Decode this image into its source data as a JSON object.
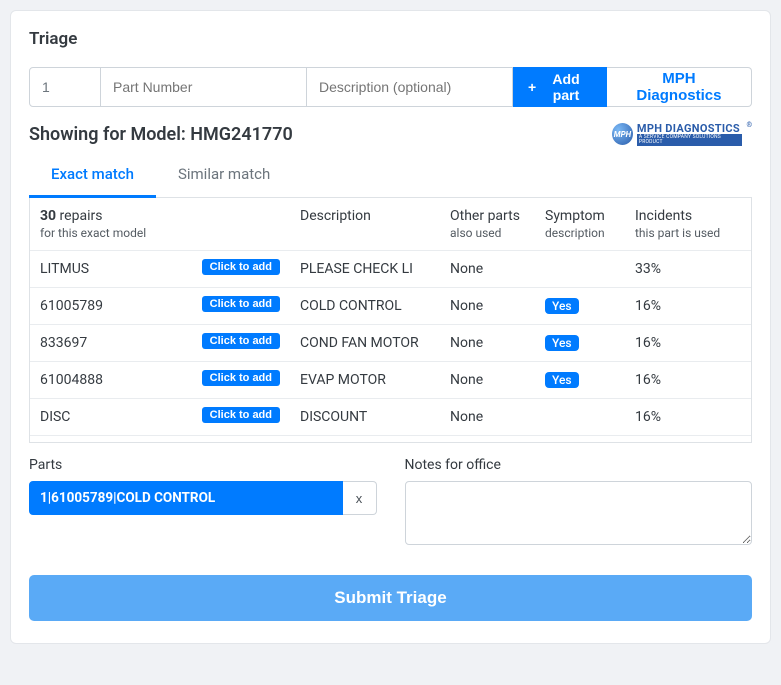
{
  "title": "Triage",
  "inputRow": {
    "qty_value": "1",
    "part_placeholder": "Part Number",
    "desc_placeholder": "Description (optional)",
    "add_label": "Add part",
    "diag_label": "MPH Diagnostics"
  },
  "model_heading": "Showing for Model: HMG241770",
  "logo": {
    "ball": "MPH",
    "main": "MPH DIAGNOSTICS",
    "sub": "A SERVICE COMPANY SOLUTIONS PRODUCT"
  },
  "tabs": {
    "exact": "Exact match",
    "similar": "Similar match"
  },
  "header": {
    "repairs_count": "30",
    "repairs_word": " repairs",
    "repairs_sub": "for this exact model",
    "description": "Description",
    "other_parts": "Other parts",
    "other_parts_sub": "also used",
    "symptom": "Symptom",
    "symptom_sub": "description",
    "incidents": "Incidents",
    "incidents_sub": "this part is used"
  },
  "add_pill_label": "Click to add",
  "yes_label": "Yes",
  "rows": [
    {
      "part": "LITMUS",
      "desc": "PLEASE CHECK LI",
      "other": "None",
      "symptom": "",
      "incidents": "33%"
    },
    {
      "part": "61005789",
      "desc": "COLD CONTROL",
      "other": "None",
      "symptom": "Yes",
      "incidents": "16%"
    },
    {
      "part": "833697",
      "desc": "COND FAN MOTOR",
      "other": "None",
      "symptom": "Yes",
      "incidents": "16%"
    },
    {
      "part": "61004888",
      "desc": "EVAP MOTOR",
      "other": "None",
      "symptom": "Yes",
      "incidents": "16%"
    },
    {
      "part": "DISC",
      "desc": "DISCOUNT",
      "other": "None",
      "symptom": "",
      "incidents": "16%"
    }
  ],
  "parts_section": {
    "label": "Parts",
    "chip": "1|61005789|COLD CONTROL",
    "x": "x"
  },
  "notes_section": {
    "label": "Notes for office"
  },
  "submit_label": "Submit Triage"
}
